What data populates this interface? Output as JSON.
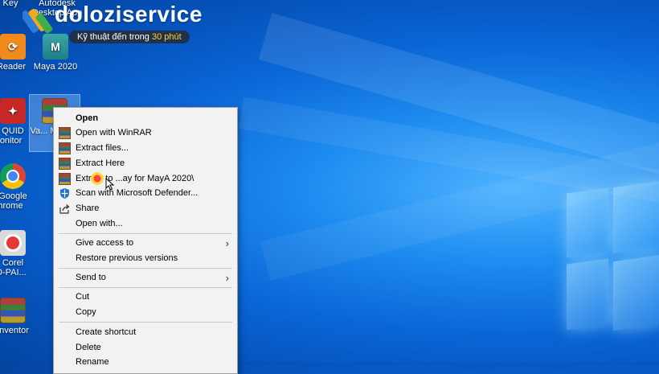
{
  "watermark": {
    "brand": "doloziservice",
    "tagline_prefix": "Kỹ thuật đến trong ",
    "tagline_highlight": "30 phút"
  },
  "desktop": {
    "icons": [
      {
        "label": "Key",
        "icon": "key-icon"
      },
      {
        "label": "Autodesk Desktop App",
        "icon": "autodesk-icon"
      },
      {
        "label": "Reader",
        "icon": "pdf-reader-icon"
      },
      {
        "label": "Maya 2020",
        "icon": "maya-icon"
      },
      {
        "label": "QUID Monitor",
        "icon": "monitor-app-icon"
      },
      {
        "label": "Va... Maya...",
        "icon": "winrar-archive-icon"
      },
      {
        "label": "Google Chrome",
        "icon": "chrome-icon"
      },
      {
        "label": "Corel ...O-PAI...",
        "icon": "corel-icon"
      },
      {
        "label": "Inventor",
        "icon": "inventor-icon"
      }
    ]
  },
  "context_menu": {
    "items": [
      {
        "label": "Open",
        "bold": true
      },
      {
        "label": "Open with WinRAR",
        "icon": "winrar-icon"
      },
      {
        "label": "Extract files...",
        "icon": "winrar-icon"
      },
      {
        "label": "Extract Here",
        "icon": "winrar-icon"
      },
      {
        "label": "Extract to ...ay for MayA 2020\\",
        "icon": "winrar-icon"
      },
      {
        "label": "Scan with Microsoft Defender...",
        "icon": "defender-shield-icon"
      },
      {
        "label": "Share",
        "icon": "share-icon"
      },
      {
        "label": "Open with..."
      },
      {
        "label": "Give access to",
        "submenu": true
      },
      {
        "label": "Restore previous versions"
      },
      {
        "label": "Send to",
        "submenu": true
      },
      {
        "label": "Cut"
      },
      {
        "label": "Copy"
      },
      {
        "label": "Create shortcut"
      },
      {
        "label": "Delete"
      },
      {
        "label": "Rename"
      }
    ]
  },
  "colors": {
    "desktop_blue": "#0a66d6",
    "menu_bg": "#f2f2f2",
    "tagline_highlight": "#ffd23c"
  }
}
